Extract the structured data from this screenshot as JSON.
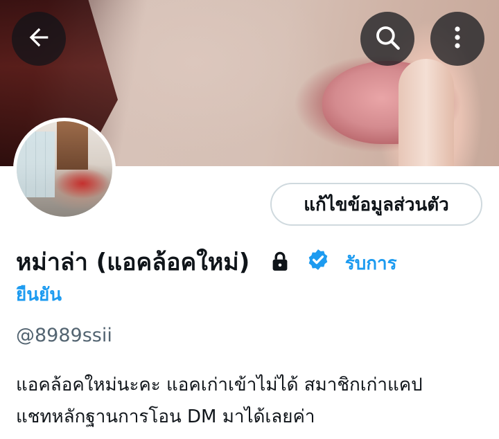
{
  "header": {
    "back_icon": "arrow-left-icon",
    "search_icon": "search-icon",
    "more_icon": "more-vertical-icon"
  },
  "profile": {
    "edit_button_label": "แก้ไขข้อมูลส่วนตัว",
    "display_name": "หม่าล่า (แอคล้อคใหม่)",
    "protected_icon": "lock-icon",
    "verified_icon": "verified-badge-icon",
    "verified_prefix": "รับการ",
    "verified_suffix": "ยืนยัน",
    "handle": "@8989ssii",
    "bio_line_1": "แอคล้อคใหม่นะคะ แอคเก่าเข้าไม่ได้ สมาชิกเก่าแคป",
    "bio_line_2": "แชทหลักฐานการโอน DM มาได้เลยค่า"
  },
  "colors": {
    "accent": "#1d9bf0",
    "text_primary": "#0f1419",
    "text_secondary": "#536471",
    "border": "#cfd9de"
  }
}
